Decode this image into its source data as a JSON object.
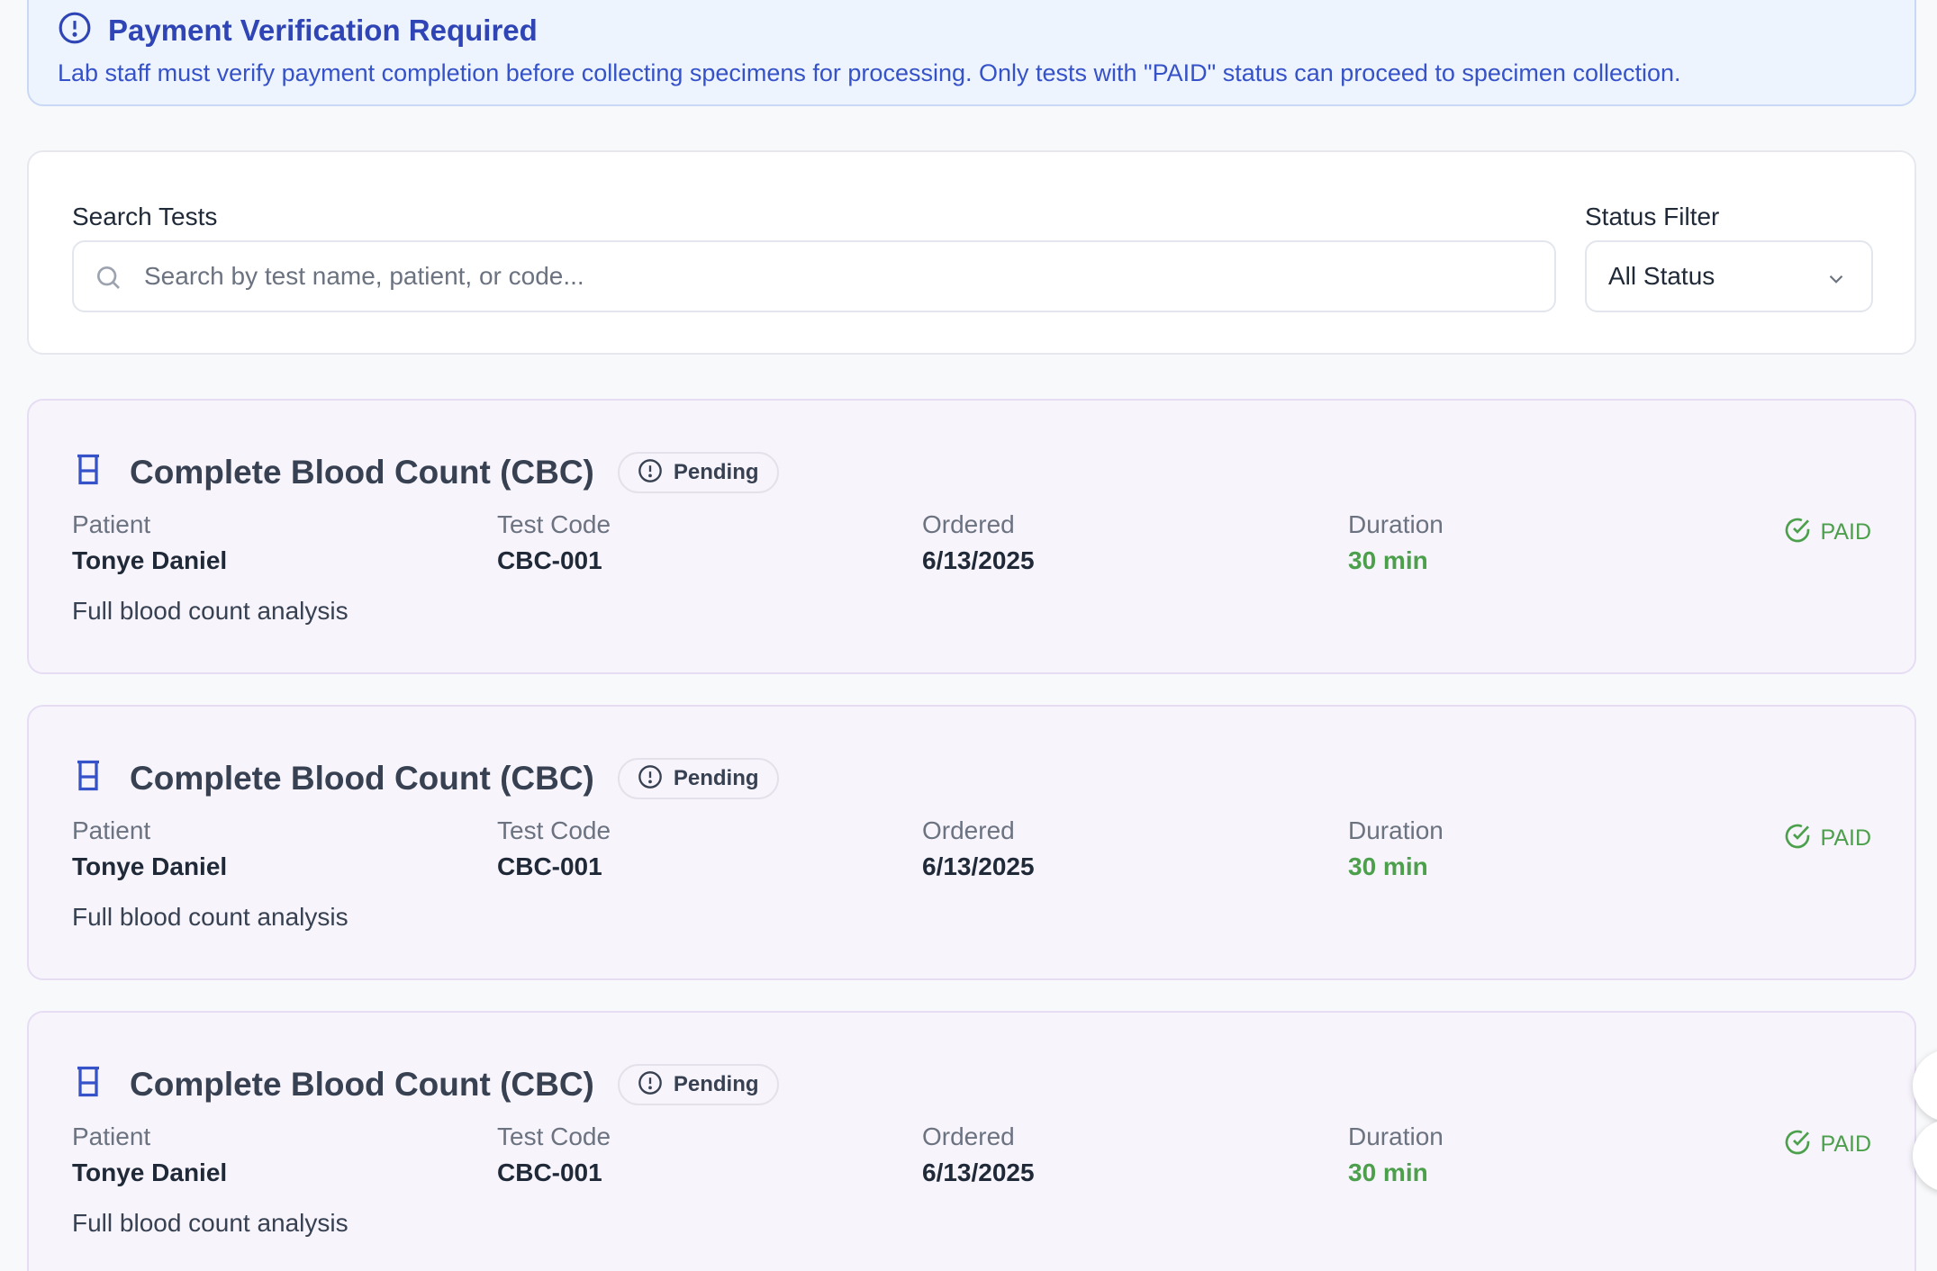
{
  "alert": {
    "title": "Payment Verification Required",
    "message": "Lab staff must verify payment completion before collecting specimens for processing. Only tests with \"PAID\" status can proceed to specimen collection.",
    "icon": "alert-circle-icon",
    "color": "#2f45b5"
  },
  "search": {
    "label": "Search Tests",
    "placeholder": "Search by test name, patient, or code...",
    "value": ""
  },
  "status_filter": {
    "label": "Status Filter",
    "selected": "All Status"
  },
  "fields": {
    "patient": "Patient",
    "code": "Test Code",
    "ordered": "Ordered",
    "duration": "Duration"
  },
  "tests": [
    {
      "title": "Complete Blood Count (CBC)",
      "status": "Pending",
      "patient": "Tonye Daniel",
      "code": "CBC-001",
      "ordered": "6/13/2025",
      "duration": "30 min",
      "description": "Full blood count analysis",
      "payment": "PAID"
    },
    {
      "title": "Complete Blood Count (CBC)",
      "status": "Pending",
      "patient": "Tonye Daniel",
      "code": "CBC-001",
      "ordered": "6/13/2025",
      "duration": "30 min",
      "description": "Full blood count analysis",
      "payment": "PAID"
    },
    {
      "title": "Complete Blood Count (CBC)",
      "status": "Pending",
      "patient": "Tonye Daniel",
      "code": "CBC-001",
      "ordered": "6/13/2025",
      "duration": "30 min",
      "description": "Full blood count analysis",
      "payment": "PAID"
    }
  ],
  "colors": {
    "accent": "#3552c8",
    "paid": "#4ca04c",
    "card_bg": "#f7f4fc"
  }
}
